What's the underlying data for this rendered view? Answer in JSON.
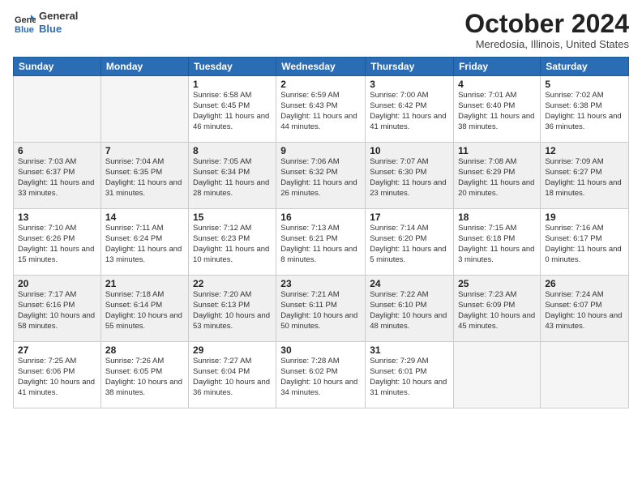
{
  "logo": {
    "general": "General",
    "blue": "Blue"
  },
  "header": {
    "month": "October 2024",
    "location": "Meredosia, Illinois, United States"
  },
  "weekdays": [
    "Sunday",
    "Monday",
    "Tuesday",
    "Wednesday",
    "Thursday",
    "Friday",
    "Saturday"
  ],
  "weeks": [
    [
      {
        "day": "",
        "info": ""
      },
      {
        "day": "",
        "info": ""
      },
      {
        "day": "1",
        "info": "Sunrise: 6:58 AM\nSunset: 6:45 PM\nDaylight: 11 hours and 46 minutes."
      },
      {
        "day": "2",
        "info": "Sunrise: 6:59 AM\nSunset: 6:43 PM\nDaylight: 11 hours and 44 minutes."
      },
      {
        "day": "3",
        "info": "Sunrise: 7:00 AM\nSunset: 6:42 PM\nDaylight: 11 hours and 41 minutes."
      },
      {
        "day": "4",
        "info": "Sunrise: 7:01 AM\nSunset: 6:40 PM\nDaylight: 11 hours and 38 minutes."
      },
      {
        "day": "5",
        "info": "Sunrise: 7:02 AM\nSunset: 6:38 PM\nDaylight: 11 hours and 36 minutes."
      }
    ],
    [
      {
        "day": "6",
        "info": "Sunrise: 7:03 AM\nSunset: 6:37 PM\nDaylight: 11 hours and 33 minutes."
      },
      {
        "day": "7",
        "info": "Sunrise: 7:04 AM\nSunset: 6:35 PM\nDaylight: 11 hours and 31 minutes."
      },
      {
        "day": "8",
        "info": "Sunrise: 7:05 AM\nSunset: 6:34 PM\nDaylight: 11 hours and 28 minutes."
      },
      {
        "day": "9",
        "info": "Sunrise: 7:06 AM\nSunset: 6:32 PM\nDaylight: 11 hours and 26 minutes."
      },
      {
        "day": "10",
        "info": "Sunrise: 7:07 AM\nSunset: 6:30 PM\nDaylight: 11 hours and 23 minutes."
      },
      {
        "day": "11",
        "info": "Sunrise: 7:08 AM\nSunset: 6:29 PM\nDaylight: 11 hours and 20 minutes."
      },
      {
        "day": "12",
        "info": "Sunrise: 7:09 AM\nSunset: 6:27 PM\nDaylight: 11 hours and 18 minutes."
      }
    ],
    [
      {
        "day": "13",
        "info": "Sunrise: 7:10 AM\nSunset: 6:26 PM\nDaylight: 11 hours and 15 minutes."
      },
      {
        "day": "14",
        "info": "Sunrise: 7:11 AM\nSunset: 6:24 PM\nDaylight: 11 hours and 13 minutes."
      },
      {
        "day": "15",
        "info": "Sunrise: 7:12 AM\nSunset: 6:23 PM\nDaylight: 11 hours and 10 minutes."
      },
      {
        "day": "16",
        "info": "Sunrise: 7:13 AM\nSunset: 6:21 PM\nDaylight: 11 hours and 8 minutes."
      },
      {
        "day": "17",
        "info": "Sunrise: 7:14 AM\nSunset: 6:20 PM\nDaylight: 11 hours and 5 minutes."
      },
      {
        "day": "18",
        "info": "Sunrise: 7:15 AM\nSunset: 6:18 PM\nDaylight: 11 hours and 3 minutes."
      },
      {
        "day": "19",
        "info": "Sunrise: 7:16 AM\nSunset: 6:17 PM\nDaylight: 11 hours and 0 minutes."
      }
    ],
    [
      {
        "day": "20",
        "info": "Sunrise: 7:17 AM\nSunset: 6:16 PM\nDaylight: 10 hours and 58 minutes."
      },
      {
        "day": "21",
        "info": "Sunrise: 7:18 AM\nSunset: 6:14 PM\nDaylight: 10 hours and 55 minutes."
      },
      {
        "day": "22",
        "info": "Sunrise: 7:20 AM\nSunset: 6:13 PM\nDaylight: 10 hours and 53 minutes."
      },
      {
        "day": "23",
        "info": "Sunrise: 7:21 AM\nSunset: 6:11 PM\nDaylight: 10 hours and 50 minutes."
      },
      {
        "day": "24",
        "info": "Sunrise: 7:22 AM\nSunset: 6:10 PM\nDaylight: 10 hours and 48 minutes."
      },
      {
        "day": "25",
        "info": "Sunrise: 7:23 AM\nSunset: 6:09 PM\nDaylight: 10 hours and 45 minutes."
      },
      {
        "day": "26",
        "info": "Sunrise: 7:24 AM\nSunset: 6:07 PM\nDaylight: 10 hours and 43 minutes."
      }
    ],
    [
      {
        "day": "27",
        "info": "Sunrise: 7:25 AM\nSunset: 6:06 PM\nDaylight: 10 hours and 41 minutes."
      },
      {
        "day": "28",
        "info": "Sunrise: 7:26 AM\nSunset: 6:05 PM\nDaylight: 10 hours and 38 minutes."
      },
      {
        "day": "29",
        "info": "Sunrise: 7:27 AM\nSunset: 6:04 PM\nDaylight: 10 hours and 36 minutes."
      },
      {
        "day": "30",
        "info": "Sunrise: 7:28 AM\nSunset: 6:02 PM\nDaylight: 10 hours and 34 minutes."
      },
      {
        "day": "31",
        "info": "Sunrise: 7:29 AM\nSunset: 6:01 PM\nDaylight: 10 hours and 31 minutes."
      },
      {
        "day": "",
        "info": ""
      },
      {
        "day": "",
        "info": ""
      }
    ]
  ]
}
